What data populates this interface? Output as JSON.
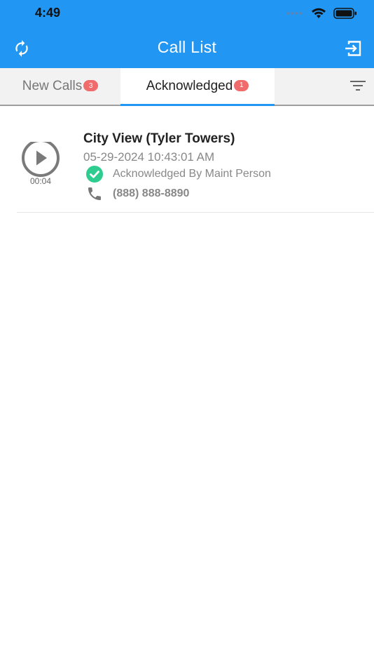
{
  "status_bar": {
    "time": "4:49"
  },
  "header": {
    "title": "Call List"
  },
  "tabs": [
    {
      "label": "New Calls",
      "count": "3"
    },
    {
      "label": "Acknowledged",
      "count": "1"
    }
  ],
  "calls": [
    {
      "name": "City View (Tyler Towers)",
      "datetime": "05-29-2024 10:43:01 AM",
      "status": "Acknowledged By Maint Person",
      "phone": "(888) 888-8890",
      "duration": "00:04"
    }
  ],
  "colors": {
    "primary": "#2196F3",
    "badge": "#f06b6b",
    "acknowledged_check": "#2ecc8f"
  },
  "icons": [
    "refresh-icon",
    "logout-icon",
    "filter-icon",
    "play-icon",
    "check-circle-icon",
    "phone-icon"
  ]
}
